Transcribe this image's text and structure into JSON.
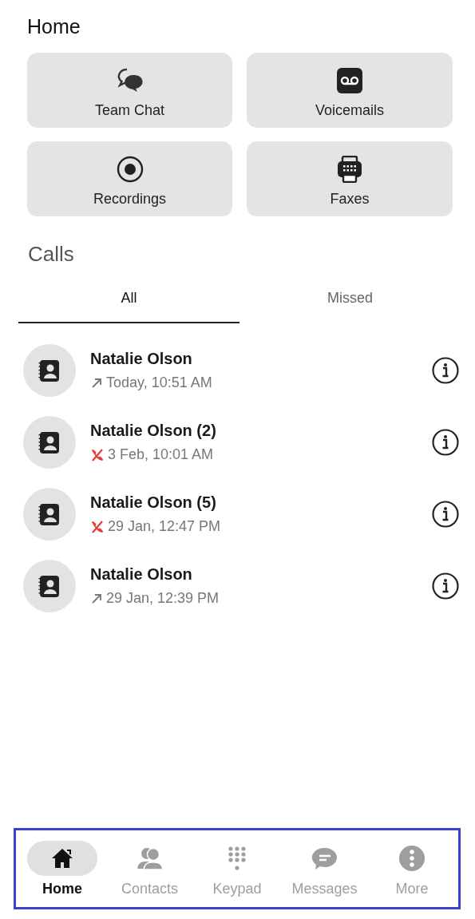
{
  "title": "Home",
  "tiles": [
    {
      "kind": "chat",
      "label": "Team Chat"
    },
    {
      "kind": "voicemail",
      "label": "Voicemails"
    },
    {
      "kind": "record",
      "label": "Recordings"
    },
    {
      "kind": "fax",
      "label": "Faxes"
    }
  ],
  "calls": {
    "heading": "Calls",
    "tabs": [
      {
        "label": "All",
        "selected": true
      },
      {
        "label": "Missed",
        "selected": false
      }
    ],
    "rows": [
      {
        "name": "Natalie Olson",
        "kind": "outgoing",
        "time": "Today, 10:51 AM"
      },
      {
        "name": "Natalie Olson (2)",
        "kind": "missed",
        "time": "3 Feb, 10:01 AM"
      },
      {
        "name": "Natalie Olson (5)",
        "kind": "missed",
        "time": "29 Jan, 12:47 PM"
      },
      {
        "name": "Natalie Olson",
        "kind": "outgoing",
        "time": "29 Jan, 12:39 PM"
      }
    ]
  },
  "nav": [
    {
      "kind": "home",
      "label": "Home",
      "selected": true
    },
    {
      "kind": "contacts",
      "label": "Contacts",
      "selected": false
    },
    {
      "kind": "keypad",
      "label": "Keypad",
      "selected": false
    },
    {
      "kind": "messages",
      "label": "Messages",
      "selected": false
    },
    {
      "kind": "more",
      "label": "More",
      "selected": false
    }
  ]
}
